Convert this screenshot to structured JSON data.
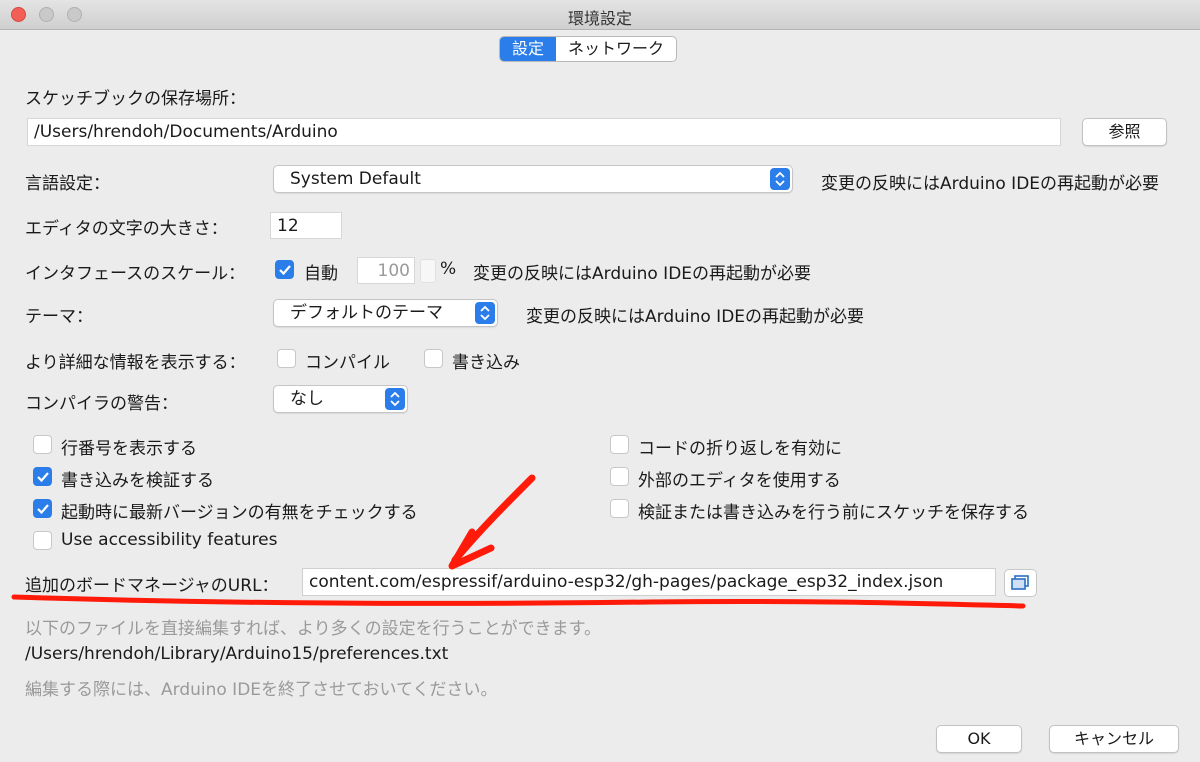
{
  "window": {
    "title": "環境設定"
  },
  "tabs": [
    {
      "label": "設定",
      "active": true
    },
    {
      "label": "ネットワーク",
      "active": false
    }
  ],
  "sketchbook": {
    "label": "スケッチブックの保存場所：",
    "path": "/Users/hrendoh/Documents/Arduino",
    "browse_label": "参照"
  },
  "language": {
    "label": "言語設定：",
    "value": "System Default",
    "note": "変更の反映にはArduino IDEの再起動が必要"
  },
  "font_size": {
    "label": "エディタの文字の大きさ：",
    "value": "12"
  },
  "scale": {
    "label": "インタフェースのスケール：",
    "auto_label": "自動",
    "auto_checked": true,
    "value": "100",
    "unit": "%",
    "note": "変更の反映にはArduino IDEの再起動が必要"
  },
  "theme": {
    "label": "テーマ：",
    "value": "デフォルトのテーマ",
    "note": "変更の反映にはArduino IDEの再起動が必要"
  },
  "verbose": {
    "label": "より詳細な情報を表示する：",
    "compile_label": "コンパイル",
    "compile_checked": false,
    "upload_label": "書き込み",
    "upload_checked": false
  },
  "warnings": {
    "label": "コンパイラの警告：",
    "value": "なし"
  },
  "options_left": [
    {
      "label": "行番号を表示する",
      "checked": false
    },
    {
      "label": "書き込みを検証する",
      "checked": true
    },
    {
      "label": "起動時に最新バージョンの有無をチェックする",
      "checked": true
    },
    {
      "label": "Use accessibility features",
      "checked": false
    }
  ],
  "options_right": [
    {
      "label": "コードの折り返しを有効に",
      "checked": false
    },
    {
      "label": "外部のエディタを使用する",
      "checked": false
    },
    {
      "label": "検証または書き込みを行う前にスケッチを保存する",
      "checked": false
    }
  ],
  "board_manager": {
    "label": "追加のボードマネージャのURL：",
    "value": "content.com/espressif/arduino-esp32/gh-pages/package_esp32_index.json"
  },
  "footer": {
    "hint": "以下のファイルを直接編集すれば、より多くの設定を行うことができます。",
    "prefs_path": "/Users/hrendoh/Library/Arduino15/preferences.txt",
    "close_hint": "編集する際には、Arduino IDEを終了させておいてください。"
  },
  "buttons": {
    "ok": "OK",
    "cancel": "キャンセル"
  },
  "colors": {
    "accent": "#2b7de9",
    "annotation": "#ff1a0a"
  }
}
